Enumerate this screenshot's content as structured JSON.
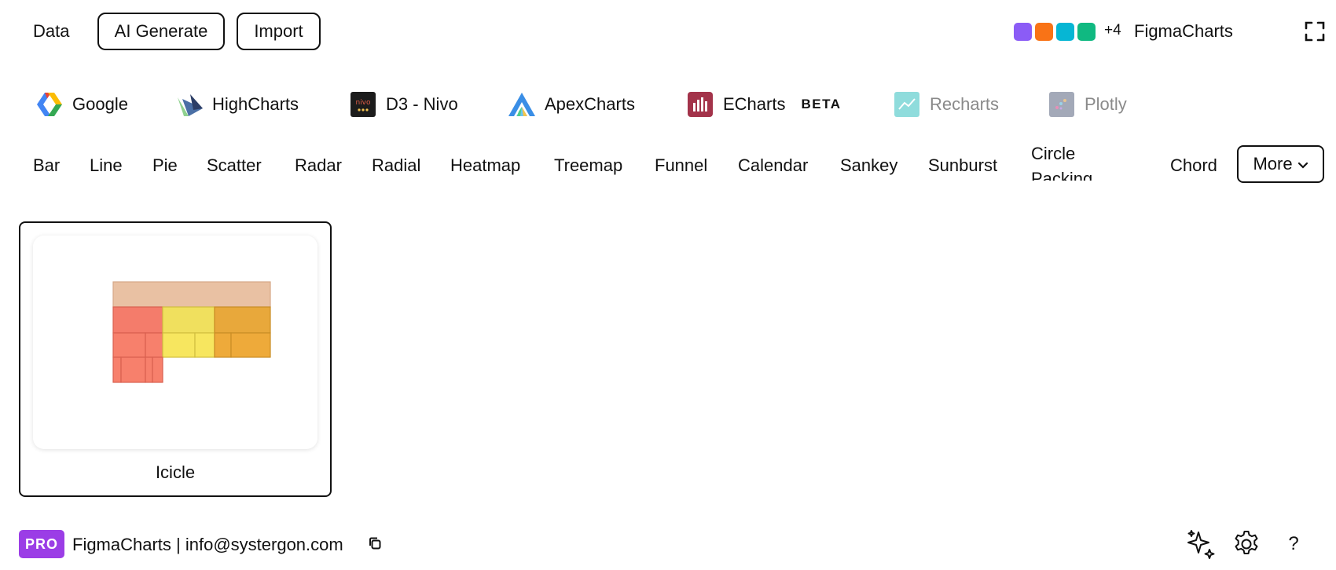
{
  "topbar": {
    "data_label": "Data",
    "ai_generate_label": "AI Generate",
    "import_label": "Import",
    "swatch_colors": [
      "#8b5cf6",
      "#f97316",
      "#06b6d4",
      "#10b981"
    ],
    "swatch_more": "+4",
    "brand": "FigmaCharts",
    "fullscreen_icon": "fullscreen-icon"
  },
  "libraries": [
    {
      "label": "Google",
      "icon": "google-icon",
      "enabled": true
    },
    {
      "label": "HighCharts",
      "icon": "highcharts-icon",
      "enabled": true
    },
    {
      "label": "D3 - Nivo",
      "icon": "nivo-icon",
      "icon_text": "nivo",
      "enabled": true
    },
    {
      "label": "ApexCharts",
      "icon": "apexcharts-icon",
      "enabled": true
    },
    {
      "label": "ECharts",
      "icon": "echarts-icon",
      "badge": "BETA",
      "enabled": true
    },
    {
      "label": "Recharts",
      "icon": "recharts-icon",
      "enabled": false
    },
    {
      "label": "Plotly",
      "icon": "plotly-icon",
      "enabled": false
    }
  ],
  "chart_types": [
    "Bar",
    "Line",
    "Pie",
    "Scatter",
    "Radar",
    "Radial",
    "Heatmap",
    "Treemap",
    "Funnel",
    "Calendar",
    "Sankey",
    "Sunburst",
    "Circle Packing",
    "Chord"
  ],
  "more_label": "More",
  "cards": [
    {
      "label": "Icicle",
      "selected": true
    }
  ],
  "footer": {
    "pro_badge": "PRO",
    "text": "FigmaCharts | info@systergon.com",
    "icons": [
      "sparkles-icon",
      "gear-icon",
      "help-icon"
    ],
    "help_glyph": "?"
  },
  "colors": {
    "pro_purple": "#9b3de6",
    "icicle_root": "#e9c1a3",
    "icicle_red": "#f47c6b",
    "icicle_yellow": "#f0e05e",
    "icicle_orange": "#e8a83b"
  }
}
